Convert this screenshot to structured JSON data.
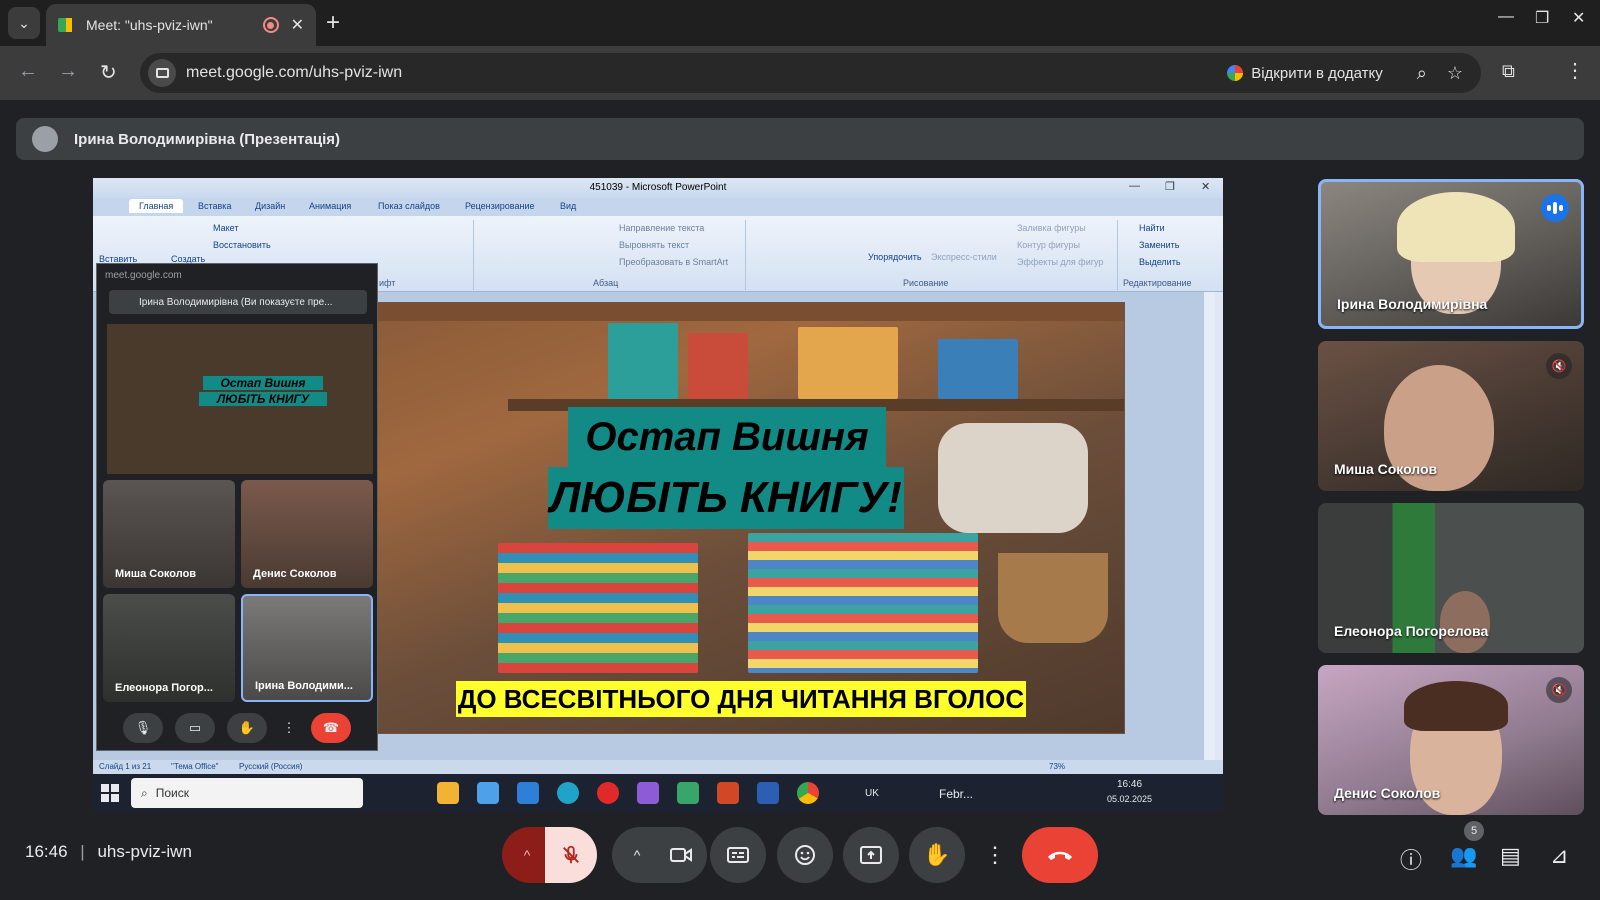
{
  "browser": {
    "tab_title": "Meet: \"uhs-pviz-iwn\"",
    "tab_close": "✕",
    "new_tab": "+",
    "url": "meet.google.com/uhs-pviz-iwn",
    "open_in_app": "Відкрити в додатку"
  },
  "presenter_bar": {
    "name": "Ірина Володимирівна (Презентація)"
  },
  "powerpoint": {
    "window_title": "451039 - Microsoft PowerPoint",
    "tabs": [
      "Главная",
      "Вставка",
      "Дизайн",
      "Анимация",
      "Показ слайдов",
      "Рецензирование",
      "Вид"
    ],
    "ribbon": {
      "paste": "Вставить",
      "create": "Создать",
      "layout": "Макет",
      "restore": "Восстановить",
      "text_direction": "Направление текста",
      "align_text": "Выровнять текст",
      "smartart": "Преобразовать в SmartArt",
      "arrange": "Упорядочить",
      "quick_styles": "Экспресс-стили",
      "shape_fill": "Заливка фигуры",
      "shape_outline": "Контур фигуры",
      "shape_effects": "Эффекты для фигур",
      "find": "Найти",
      "replace": "Заменить",
      "select": "Выделить",
      "group_paragraph": "Абзац",
      "group_drawing": "Рисование",
      "group_editing": "Редактирование",
      "group_font": "ифт"
    },
    "slide": {
      "line1": "Остап Вишня",
      "line2": "ЛЮБІТЬ КНИГУ!",
      "bottom": "ДО ВСЕСВІТНЬОГО ДНЯ ЧИТАННЯ ВГОЛОС"
    },
    "status": {
      "slide": "Слайд 1 из 21",
      "theme": "\"Тема Office\"",
      "language": "Русский (Россия)",
      "zoom": "73%"
    }
  },
  "taskbar": {
    "search": "Поиск",
    "lang": "UK",
    "weather": "Febr...",
    "time": "16:46",
    "date": "05.02.2025"
  },
  "mini_meet": {
    "url": "meet.google.com",
    "bar": "Ірина Володимирівна (Ви показуєте пре...",
    "preview_line1": "Остап Вишня",
    "preview_line2": "ЛЮБІТЬ КНИГУ",
    "tiles": [
      "Миша Соколов",
      "Денис Соколов",
      "Елеонора Погор...",
      "Ірина Володими..."
    ]
  },
  "participants": [
    {
      "name": "Ірина Володимирівна",
      "speaking": true
    },
    {
      "name": "Миша Соколов",
      "muted": true
    },
    {
      "name": "Елеонора Погорелова"
    },
    {
      "name": "Денис Соколов",
      "muted": true
    }
  ],
  "bottom_bar": {
    "time": "16:46",
    "meeting_code": "uhs-pviz-iwn",
    "people_count": "5"
  },
  "icons": {
    "mic": "mic-off-icon",
    "camera": "camera-icon",
    "captions": "captions-icon",
    "emoji": "emoji-icon",
    "present": "present-icon",
    "hand": "raise-hand-icon",
    "more": "more-vert-icon",
    "end": "end-call-icon",
    "info": "info-icon",
    "people": "people-icon",
    "chat": "chat-icon",
    "activities": "activities-icon"
  },
  "colors": {
    "end_call": "#ea4335",
    "speaking_border": "#8ab4f8",
    "slide_title_bg": "#128a86",
    "slide_banner_bg": "#ffff2e"
  }
}
